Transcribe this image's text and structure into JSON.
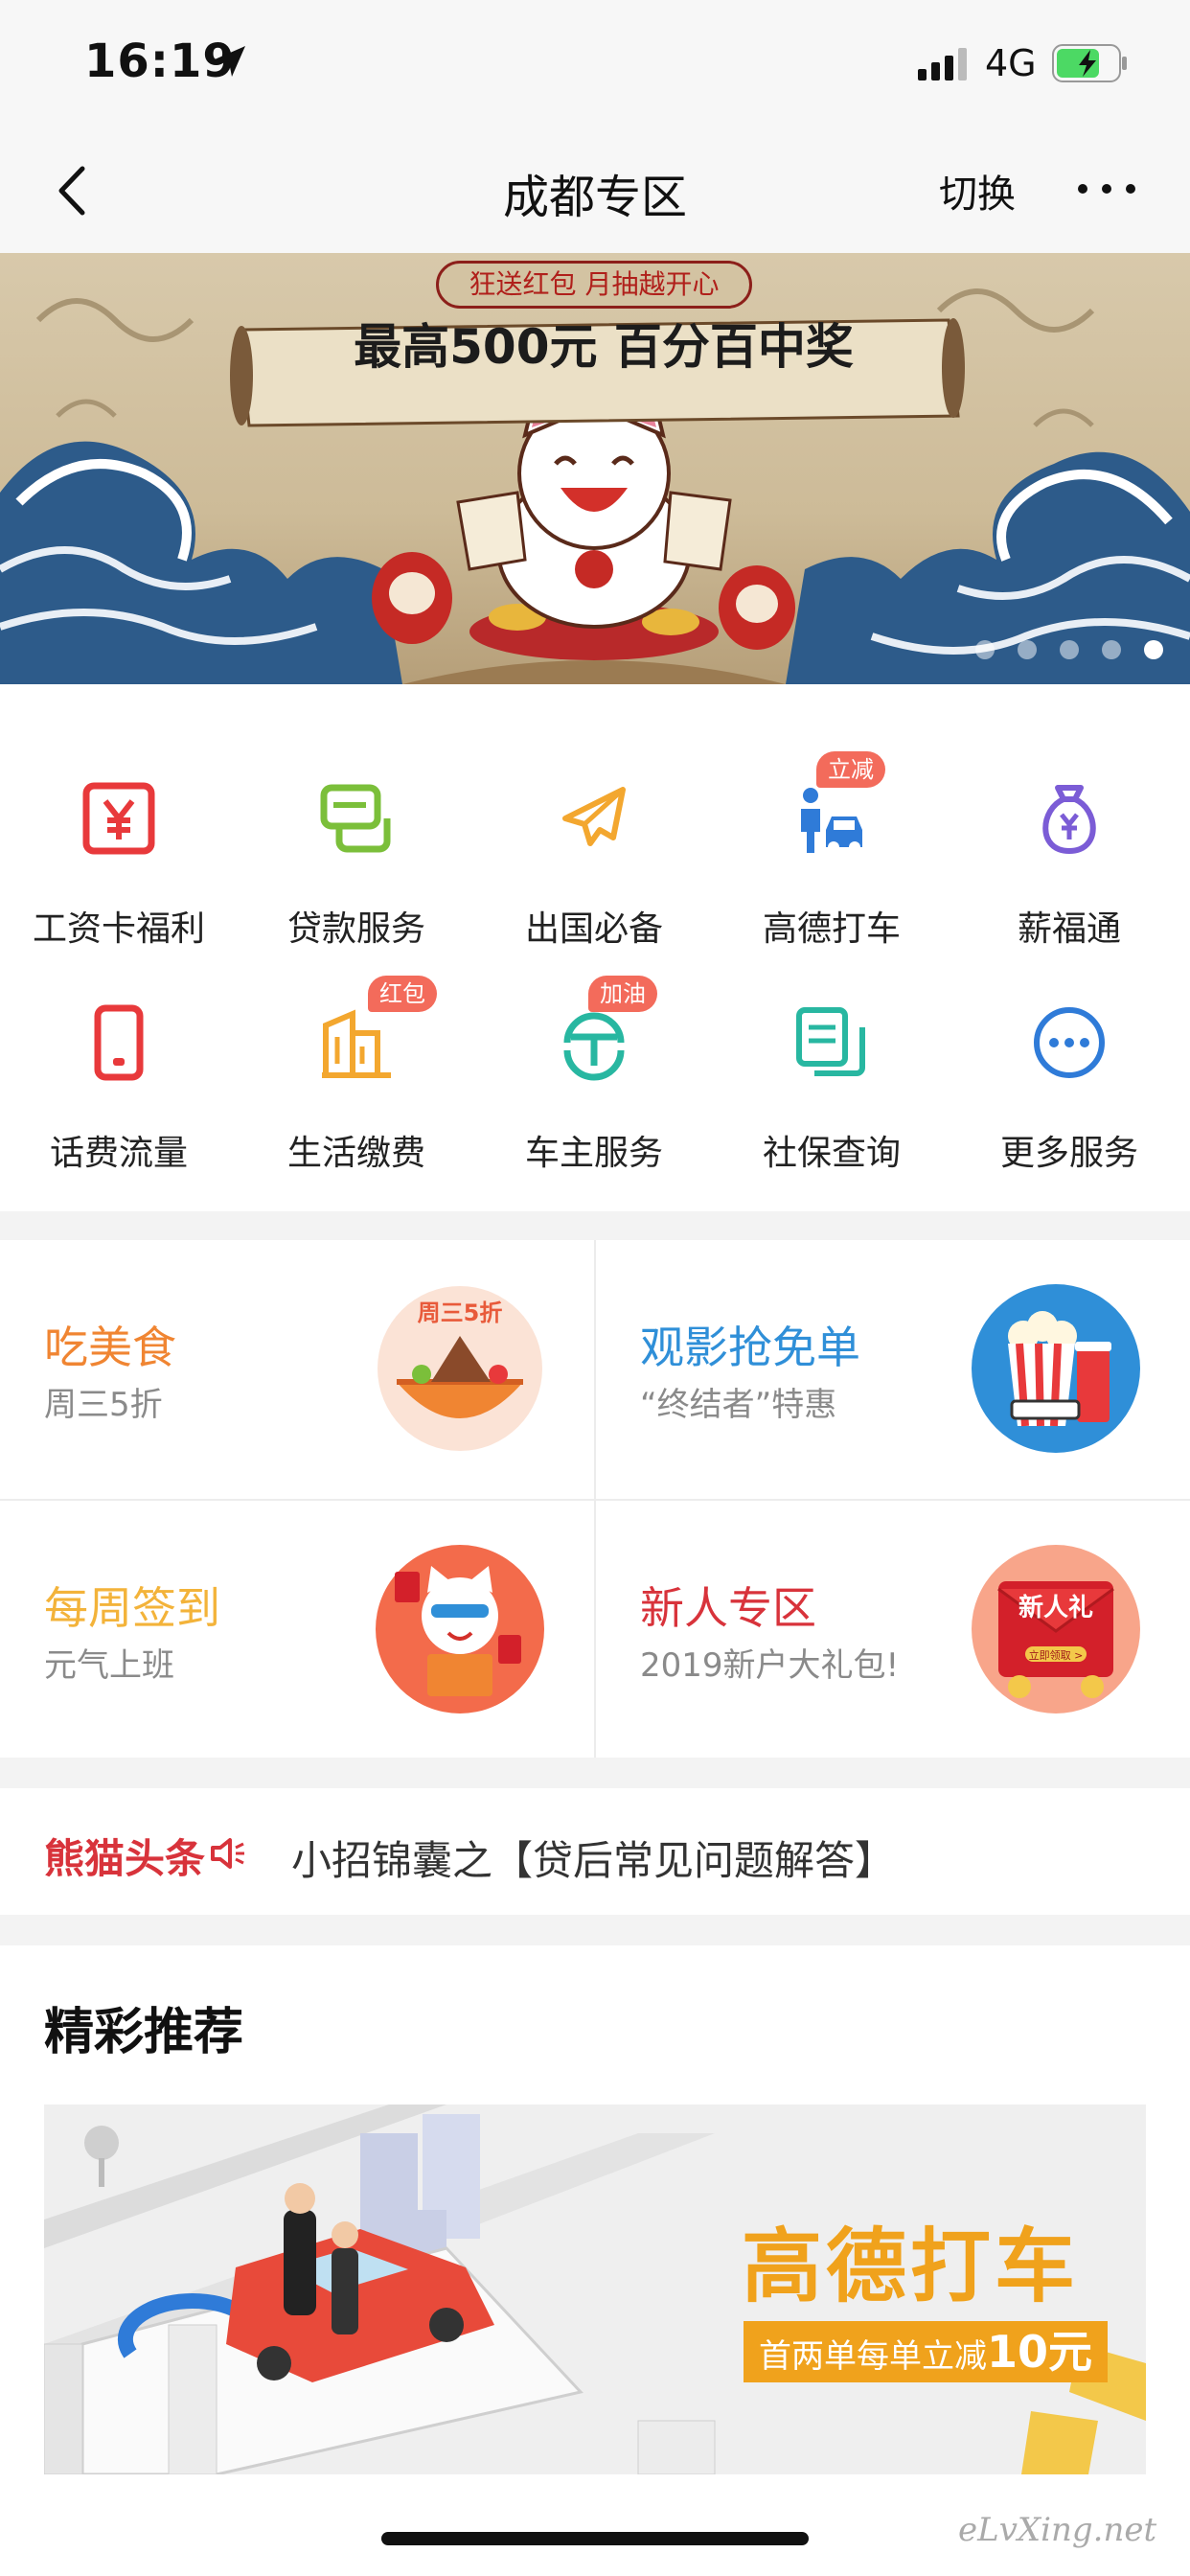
{
  "status_bar": {
    "time": "16:19",
    "network": "4G"
  },
  "nav": {
    "title": "成都专区",
    "switch_label": "切换"
  },
  "banner": {
    "top_text": "狂送红包 月抽越开心",
    "main_text": "最高500元 百分百中奖",
    "slides_total": 5,
    "active_slide": 5
  },
  "services": [
    {
      "label": "工资卡福利",
      "icon": "yuan-icon",
      "color": "#e8393b"
    },
    {
      "label": "贷款服务",
      "icon": "card-icon",
      "color": "#7bbf3a"
    },
    {
      "label": "出国必备",
      "icon": "airplane-icon",
      "color": "#f3a72f"
    },
    {
      "label": "高德打车",
      "icon": "taxi-icon",
      "color": "#2f7bd8",
      "tag": "立减"
    },
    {
      "label": "薪福通",
      "icon": "money-bag-icon",
      "color": "#7b5cd6"
    },
    {
      "label": "话费流量",
      "icon": "phone-icon",
      "color": "#e8393b"
    },
    {
      "label": "生活缴费",
      "icon": "building-icon",
      "color": "#f3a72f",
      "tag": "红包"
    },
    {
      "label": "车主服务",
      "icon": "car-owner-icon",
      "color": "#28b7a1",
      "tag": "加油"
    },
    {
      "label": "社保查询",
      "icon": "document-icon",
      "color": "#28b7a1"
    },
    {
      "label": "更多服务",
      "icon": "more-circle-icon",
      "color": "#2f7bd8"
    }
  ],
  "promos": [
    {
      "title": "吃美食",
      "subtitle": "周三5折",
      "title_color": "#f08532",
      "badge": "周三5折"
    },
    {
      "title": "观影抢免单",
      "subtitle": "“终结者”特惠",
      "title_color": "#2f8fd8"
    },
    {
      "title": "每周签到",
      "subtitle": "元气上班",
      "title_color": "#f3b33a"
    },
    {
      "title": "新人专区",
      "subtitle": "2019新户大礼包!",
      "title_color": "#d8333b",
      "badge": "新人礼",
      "badge_sub": "立即领取 >"
    }
  ],
  "news": {
    "brand": "熊猫头条",
    "headline": "小招锦囊之【贷后常见问题解答】"
  },
  "recommend": {
    "section_title": "精彩推荐",
    "card_brand": "高德打车",
    "card_offer": "首两单每单立减",
    "card_offer_amount": "10元"
  },
  "watermark": "eLvXing.net"
}
